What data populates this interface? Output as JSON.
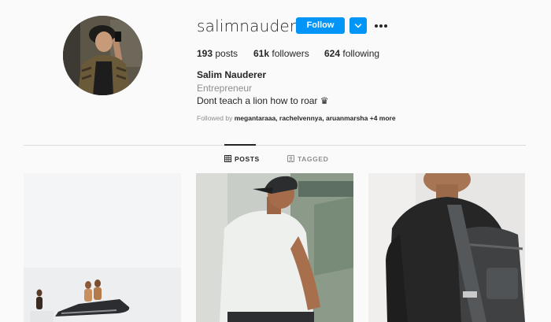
{
  "profile": {
    "username": "salimnauderer",
    "follow_label": "Follow",
    "posts_count": "193",
    "posts_label": "posts",
    "followers_count": "61k",
    "followers_label": "followers",
    "following_count": "624",
    "following_label": "following",
    "full_name": "Salim Nauderer",
    "category": "Entrepreneur",
    "bio": "Dont teach a lion how to roar ♛",
    "followed_by_prefix": "Followed by",
    "followed_by_names": "megantaraaa, rachelvennya, aruanmarsha",
    "followed_by_more": "+4 more"
  },
  "tabs": {
    "posts": "POSTS",
    "tagged": "TAGGED",
    "active": "posts"
  },
  "icons": {
    "avatar": "profile-photo",
    "dropdown": "chevron-down-icon",
    "more": "more-options-icon",
    "posts_tab": "grid-icon",
    "tagged_tab": "tag-icon"
  },
  "colors": {
    "accent": "#0095f6",
    "text": "#262626",
    "muted": "#8e8e8e",
    "background": "#fafafa",
    "divider": "#dbdbdb"
  }
}
